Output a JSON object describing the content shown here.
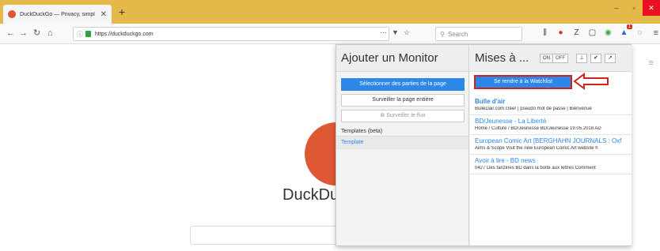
{
  "browser": {
    "tab_title": "DuckDuckGo — Privacy, simpl",
    "tab_close": "✕",
    "new_tab": "+",
    "url": "https://duckduckgo.com",
    "search_placeholder": "Search",
    "page_actions": "···",
    "window_controls": [
      "–",
      "▫",
      "✕"
    ]
  },
  "page": {
    "wordmark": "DuckDu"
  },
  "extension": {
    "left_title": "Ajouter un Monitor",
    "select_parts": "Sélectionner des parties de la page",
    "monitor_page": "Surveiller la page entière",
    "monitor_feed": "Surveiller le flux",
    "templates_label": "Templates (beta)",
    "template_link": "Template",
    "right_title": "Mises à ...",
    "toggle_on": "ON",
    "toggle_off": "OFF",
    "watchlist_button": "Se rendre à la Watchlist",
    "feeds": [
      {
        "title": "Bulle d'air",
        "snippet": "BulleDair.com créer | pseudo mot de passe | Bienvenue"
      },
      {
        "title": "BD/Jeunesse - La Liberté",
        "snippet": "Home / Culture / BD/Jeunesse BD/Jeunesse 19.05.2018 AD"
      },
      {
        "title": "European Comic Art [BERGHAHN JOURNALS : Oxf",
        "snippet": "Aims & Scope Visit the new European Comic Art website h"
      },
      {
        "title": "Avoir à lire - BD news",
        "snippet": "0427 Des fanzines BD dans la boîte aux lettres Comment"
      }
    ]
  },
  "colors": {
    "titlebar": "#e4b94a",
    "accent": "#2d87e8",
    "highlight": "#d32020"
  }
}
